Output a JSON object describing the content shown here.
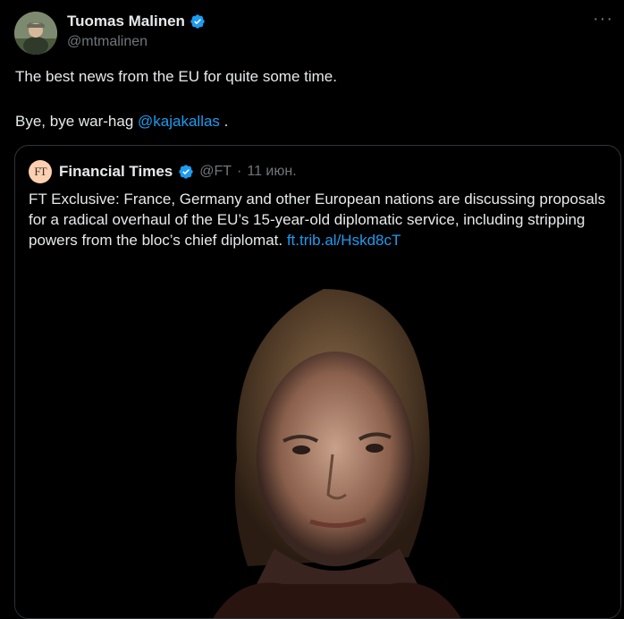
{
  "author": {
    "name": "Tuomas Malinen",
    "handle": "@mtmalinen"
  },
  "tweet": {
    "line1": "The best news from the EU for quite some time.",
    "line2_prefix": "Bye, bye war-hag ",
    "mention": "@kajakallas",
    "line2_suffix": " ."
  },
  "quoted": {
    "logo_text": "FT",
    "name": "Financial Times",
    "handle": "@FT",
    "separator": "·",
    "date": "11 июн.",
    "body": "FT Exclusive: France, Germany and other European nations are discussing proposals for a radical overhaul of the EU’s 15-year-old diplomatic service, including stripping powers from the bloc’s chief diplomat. ",
    "link": "ft.trib.al/Hskd8cT"
  },
  "colors": {
    "accent": "#1d9bf0",
    "background": "#000000",
    "muted": "#71767b",
    "text": "#e7e9ea"
  },
  "icons": {
    "verified": "verified-badge-icon",
    "more": "more-options-icon"
  }
}
